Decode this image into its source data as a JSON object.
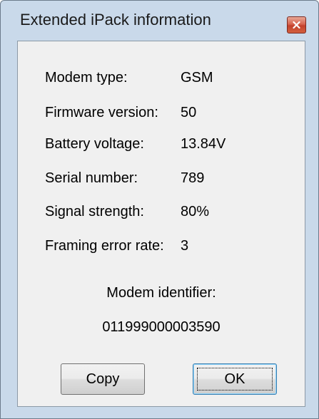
{
  "window": {
    "title": "Extended iPack information"
  },
  "fields": [
    {
      "label": "Modem type:",
      "value": "GSM"
    },
    {
      "label": "Firmware version:",
      "value": "50"
    },
    {
      "label": "Battery voltage:",
      "value": "13.84V"
    },
    {
      "label": "Serial number:",
      "value": "789"
    },
    {
      "label": "Signal strength:",
      "value": "80%"
    },
    {
      "label": "Framing error rate:",
      "value": "3"
    }
  ],
  "modem_identifier": {
    "label": "Modem identifier:",
    "value": "011999000003590"
  },
  "buttons": {
    "copy_label": "Copy",
    "ok_label": "OK"
  },
  "icons": {
    "close": "close-icon"
  }
}
